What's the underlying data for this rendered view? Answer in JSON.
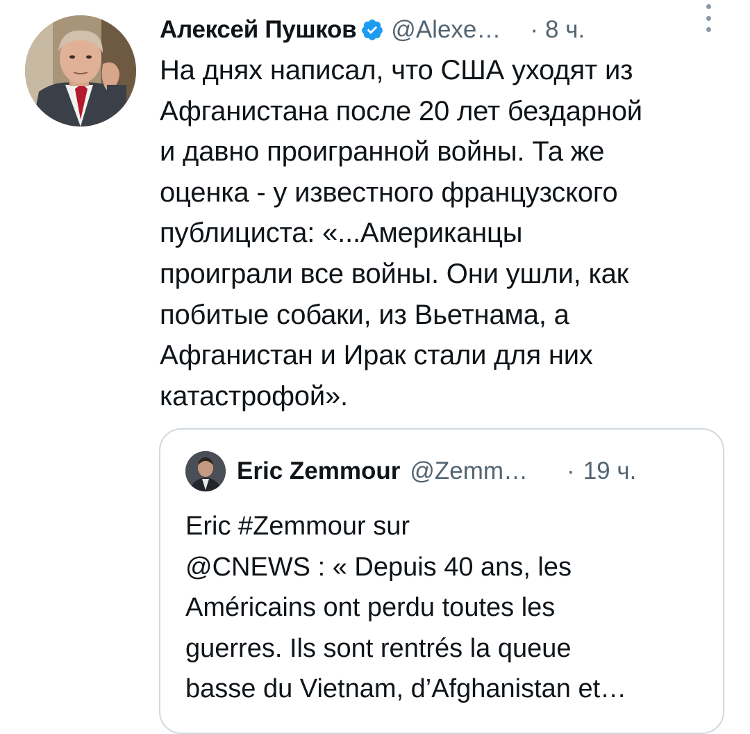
{
  "tweet": {
    "author_name": "Алексей Пушков",
    "handle": "@Alexe…",
    "separator": "·",
    "time": "8 ч.",
    "text": "На днях написал, что США уходят из\nАфганистана после 20 лет бездарной\nи давно проигранной войны. Та же\nоценка - у  известного французского\nпублициста: «...Американцы\nпроиграли все войны. Они ушли, как\nпобитые собаки, из Вьетнама, а\nАфганистан и Ирак стали для них\nкатастрофой».",
    "verified_icon": "verified-badge-icon",
    "more_icon": "more-vertical-icon",
    "colors": {
      "verified": "#1d9bf0",
      "secondary_text": "#536471",
      "border": "#cfd9de"
    }
  },
  "quote": {
    "author_name": "Eric Zemmour",
    "handle": "@Zemm…",
    "separator": "·",
    "time": "19 ч.",
    "text": "Eric #Zemmour sur\n@CNEWS : « Depuis 40 ans, les\nAméricains ont perdu toutes les\nguerres. Ils sont rentrés la queue\nbasse du Vietnam, d’Afghanistan et…"
  }
}
